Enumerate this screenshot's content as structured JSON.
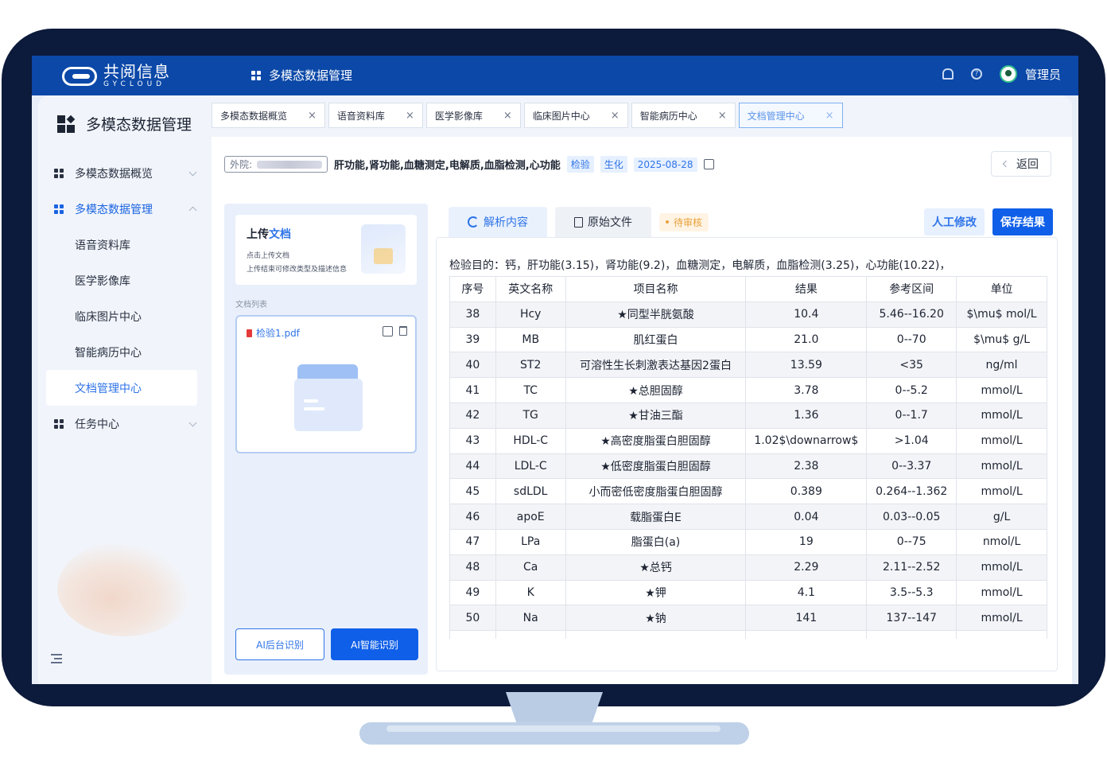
{
  "header": {
    "logo_cn": "共阅信息",
    "logo_en": "GYCLOUD",
    "title": "多模态数据管理",
    "user": "管理员"
  },
  "sidebar": {
    "title": "多模态数据管理",
    "items": [
      {
        "label": "多模态数据概览"
      },
      {
        "label": "多模态数据管理"
      },
      {
        "label": "语音资料库"
      },
      {
        "label": "医学影像库"
      },
      {
        "label": "临床图片中心"
      },
      {
        "label": "智能病历中心"
      },
      {
        "label": "文档管理中心"
      },
      {
        "label": "任务中心"
      }
    ]
  },
  "tabs": [
    {
      "label": "多模态数据概览"
    },
    {
      "label": "语音资料库"
    },
    {
      "label": "医学影像库"
    },
    {
      "label": "临床图片中心"
    },
    {
      "label": "智能病历中心"
    },
    {
      "label": "文档管理中心"
    }
  ],
  "tab_close": "×",
  "document": {
    "hospital_label": "外院:",
    "title": "肝功能,肾功能,血糖测定,电解质,血脂检测,心功能",
    "tags": [
      "检验",
      "生化",
      "2025-08-28"
    ],
    "back_label": "返回"
  },
  "upload": {
    "title_prefix": "上传",
    "title_highlight": "文档",
    "hint_1": "点击上传文档",
    "hint_2": "上传结束可修改类型及描述信息",
    "list_label": "文档列表",
    "file_name": "检验1.pdf",
    "btn_backend": "AI后台识别",
    "btn_smart": "AI智能识别"
  },
  "result": {
    "tab_parsed": "解析内容",
    "tab_original": "原始文件",
    "status": "待审核",
    "btn_manual": "人工修改",
    "btn_save": "保存结果",
    "purpose": "检验目的：钙，肝功能(3.15)，肾功能(9.2)，血糖测定，电解质，血脂检测(3.25)，心功能(10.22)，",
    "columns": [
      "序号",
      "英文名称",
      "项目名称",
      "结果",
      "参考区间",
      "单位"
    ],
    "rows": [
      [
        "38",
        "Hcy",
        "★同型半胱氨酸",
        "10.4",
        "5.46--16.20",
        "$\\mu$ mol/L"
      ],
      [
        "39",
        "MB",
        "肌红蛋白",
        "21.0",
        "0--70",
        "$\\mu$ g/L"
      ],
      [
        "40",
        "ST2",
        "可溶性生长刺激表达基因2蛋白",
        "13.59",
        "<35",
        "ng/ml"
      ],
      [
        "41",
        "TC",
        "★总胆固醇",
        "3.78",
        "0--5.2",
        "mmol/L"
      ],
      [
        "42",
        "TG",
        "★甘油三酯",
        "1.36",
        "0--1.7",
        "mmol/L"
      ],
      [
        "43",
        "HDL-C",
        "★高密度脂蛋白胆固醇",
        "1.02$\\downarrow$",
        ">1.04",
        "mmol/L"
      ],
      [
        "44",
        "LDL-C",
        "★低密度脂蛋白胆固醇",
        "2.38",
        "0--3.37",
        "mmol/L"
      ],
      [
        "45",
        "sdLDL",
        "小而密低密度脂蛋白胆固醇",
        "0.389",
        "0.264--1.362",
        "mmol/L"
      ],
      [
        "46",
        "apoE",
        "载脂蛋白E",
        "0.04",
        "0.03--0.05",
        "g/L"
      ],
      [
        "47",
        "LPa",
        "脂蛋白(a)",
        "19",
        "0--75",
        "nmol/L"
      ],
      [
        "48",
        "Ca",
        "★总钙",
        "2.29",
        "2.11--2.52",
        "mmol/L"
      ],
      [
        "49",
        "K",
        "★钾",
        "4.1",
        "3.5--5.3",
        "mmol/L"
      ],
      [
        "50",
        "Na",
        "★钠",
        "141",
        "137--147",
        "mmol/L"
      ],
      [
        "",
        "",
        "",
        "",
        "",
        ""
      ]
    ]
  },
  "colors": {
    "brand": "#0b48a8",
    "primary": "#0f5fe8",
    "accent": "#2f74e8",
    "pending": "#e8a03a"
  }
}
